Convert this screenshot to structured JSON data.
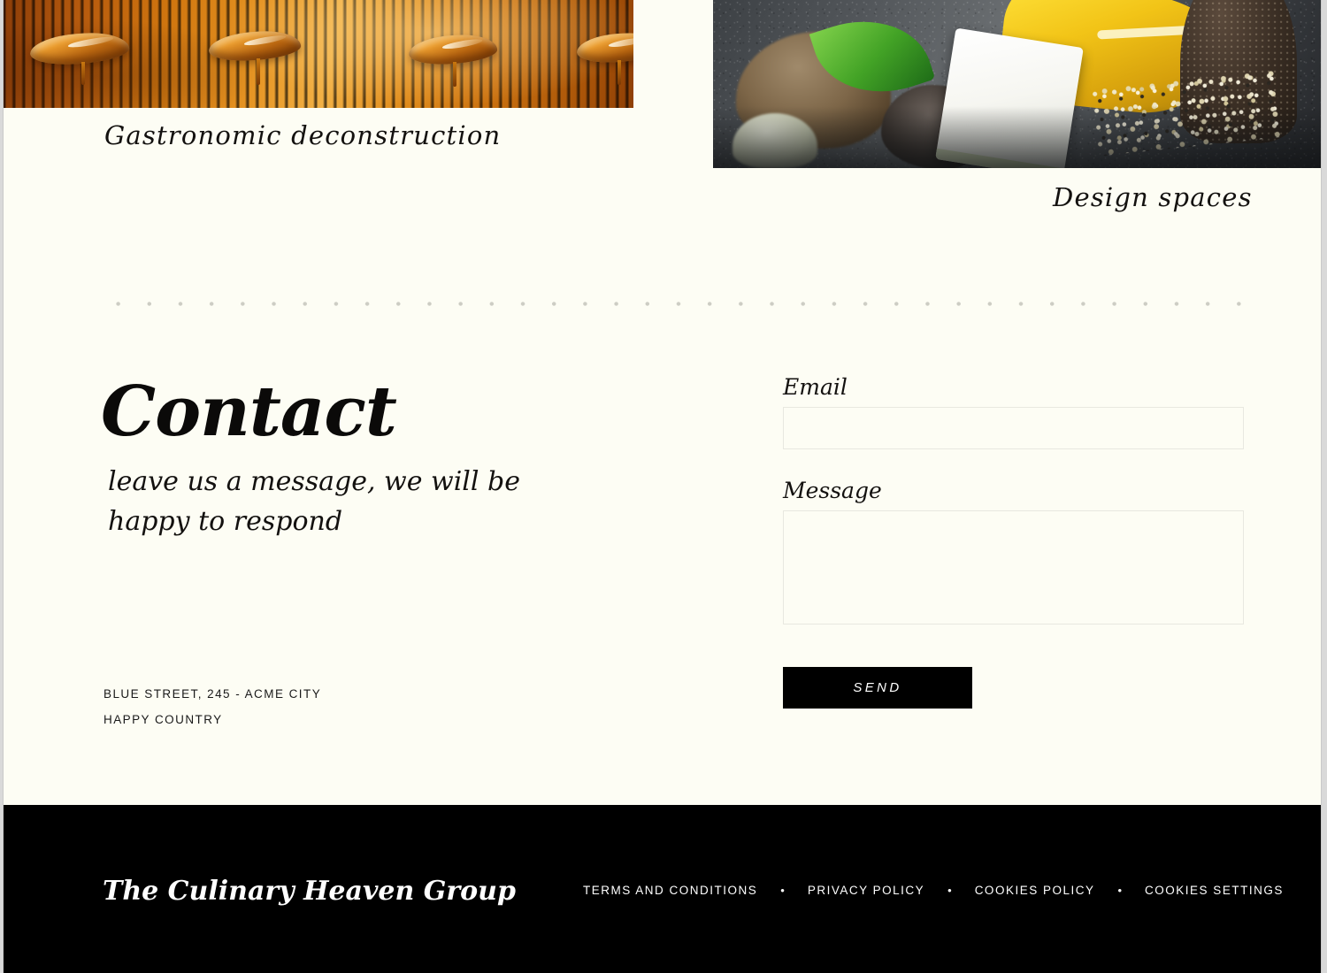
{
  "page": {
    "background_color": "#fdfdf4",
    "footer_color": "#000000",
    "accent_color": "#e08c1c"
  },
  "hero": {
    "left_image_alt": "amber ribbed surface with glossy caramel drops",
    "left_caption": "Gastronomic deconstruction",
    "right_image_alt": "plated gourmet dessert on dark slate",
    "right_caption": "Design spaces"
  },
  "contact": {
    "heading": "Contact",
    "subtitle": "leave us a message, we will be happy to respond",
    "address_line1": "Blue Street, 245  -  Acme City",
    "address_line2": "Happy Country"
  },
  "form": {
    "email_label": "Email",
    "email_value": "",
    "email_placeholder": "",
    "message_label": "Message",
    "message_value": "",
    "message_placeholder": "",
    "send_label": "SEND"
  },
  "footer": {
    "logo": "The Culinary Heaven Group",
    "separator": "•",
    "links": [
      {
        "label": "Terms and Conditions"
      },
      {
        "label": "Privacy Policy"
      },
      {
        "label": "Cookies Policy"
      },
      {
        "label": "Cookies Settings"
      }
    ]
  }
}
